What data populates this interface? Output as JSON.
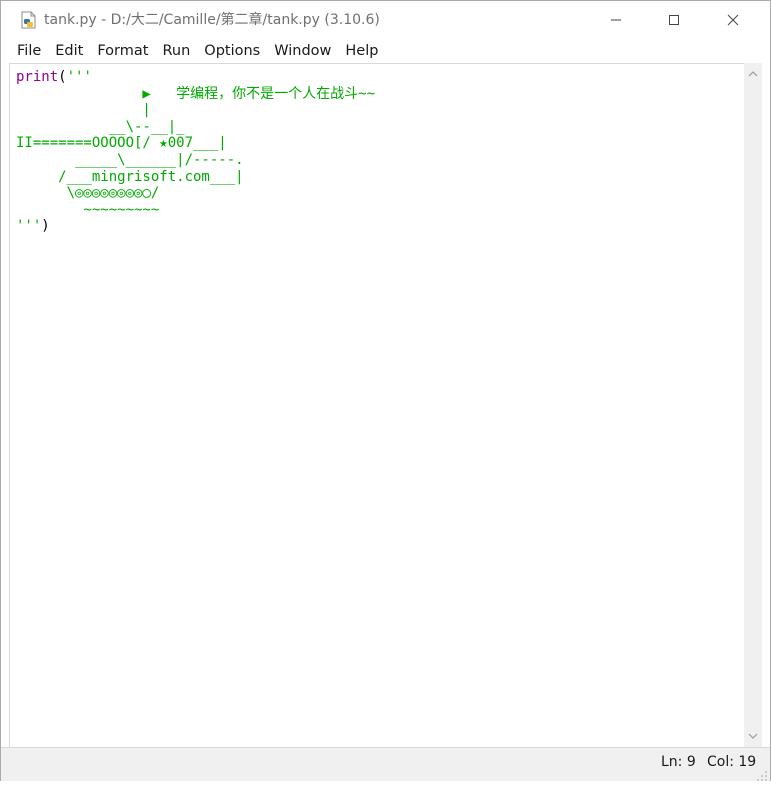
{
  "window": {
    "title": "tank.py - D:/大二/Camille/第二章/tank.py (3.10.6)",
    "icon": "python-file-icon"
  },
  "menu": {
    "items": [
      "File",
      "Edit",
      "Format",
      "Run",
      "Options",
      "Window",
      "Help"
    ]
  },
  "editor": {
    "builtin": "print",
    "open_paren": "(",
    "string_open": "'''",
    "lines": [
      "               ▶   学编程，你不是一个人在战斗~~",
      "               |",
      "           __\\--__|_",
      "II=======OOOOO[/ ★007___|",
      "       _____\\______|/-----.",
      "     /___mingrisoft.com___|",
      "      \\◎◎◎◎◎◎◎◎◯/",
      "        ~~~~~~~~~"
    ],
    "string_close": "'''",
    "close_paren": ")"
  },
  "status": {
    "ln": "Ln: 9",
    "col": "Col: 19"
  },
  "colors": {
    "builtin": "#900090",
    "string": "#00aa00",
    "text": "#000000"
  }
}
